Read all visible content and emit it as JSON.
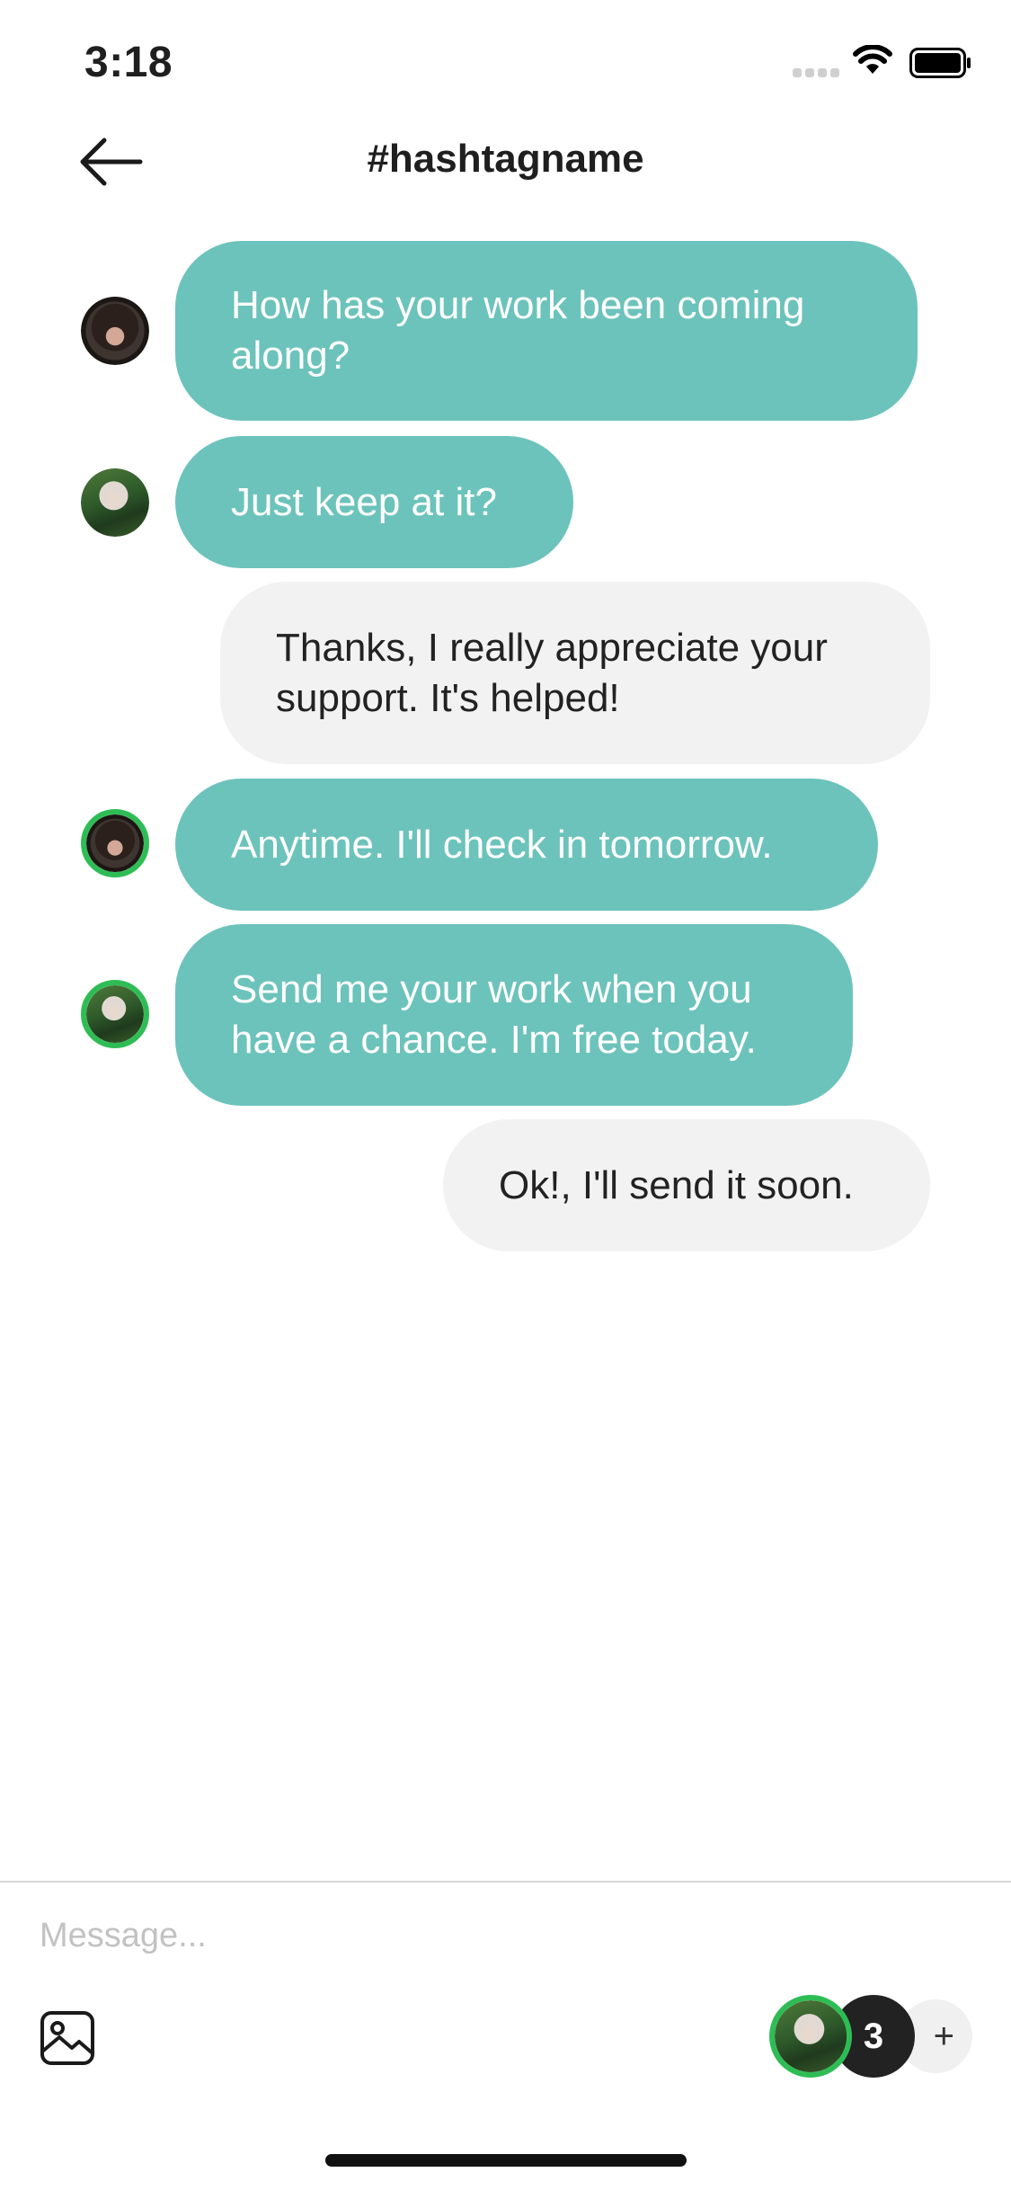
{
  "status_bar": {
    "time": "3:18",
    "icons": [
      "signal-icon",
      "wifi-icon",
      "battery-icon"
    ]
  },
  "header": {
    "back_icon": "arrow-left-icon",
    "title": "#hashtagname"
  },
  "messages": [
    {
      "direction": "incoming",
      "avatar": "dark-haired-person",
      "avatar_online": false,
      "text": "How has your work been coming along?"
    },
    {
      "direction": "incoming",
      "avatar": "blonde-person",
      "avatar_online": false,
      "text": "Just keep at it?"
    },
    {
      "direction": "outgoing",
      "text": "Thanks, I really appreciate your support. It's helped!"
    },
    {
      "direction": "incoming",
      "avatar": "dark-haired-person",
      "avatar_online": true,
      "text": "Anytime. I'll check in tomorrow."
    },
    {
      "direction": "incoming",
      "avatar": "blonde-person",
      "avatar_online": true,
      "text": "Send me your work when you have a chance. I'm free today."
    },
    {
      "direction": "outgoing",
      "text": "Ok!, I'll send it soon."
    }
  ],
  "composer": {
    "placeholder": "Message...",
    "value": "",
    "image_icon": "image-icon",
    "participant_count": "3",
    "add_label": "+"
  },
  "colors": {
    "incoming_bubble": "#6cc3bb",
    "outgoing_bubble": "#f2f2f2",
    "online_ring": "#2ebd55",
    "badge": "#222222"
  }
}
